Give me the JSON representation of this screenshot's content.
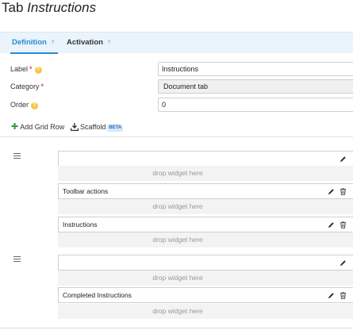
{
  "page": {
    "title_prefix": "Tab",
    "title_name": "Instructions"
  },
  "tabs": [
    {
      "label": "Definition",
      "help": "?"
    },
    {
      "label": "Activation",
      "help": "?"
    }
  ],
  "form": {
    "label": {
      "label": "Label",
      "required": "*",
      "help": "?",
      "value": "Instructions"
    },
    "category": {
      "label": "Category",
      "required": "*",
      "value": "Document tab"
    },
    "order": {
      "label": "Order",
      "help": "?",
      "value": "0"
    }
  },
  "toolbar": {
    "add_grid_row": "Add Grid Row",
    "scaffold": "Scaffold",
    "beta": "BETA"
  },
  "grid": {
    "drop_label": "drop widget here",
    "widgets": [
      {
        "title": ""
      },
      {
        "title": "Toolbar actions"
      },
      {
        "title": "Instructions"
      },
      {
        "title": ""
      },
      {
        "title": "Completed Instructions"
      }
    ]
  },
  "icons": [
    "help-icon",
    "plus-icon",
    "download-icon",
    "drag-handle-icon",
    "pencil-icon",
    "trash-icon"
  ],
  "colors": {
    "accent": "#2a8ad4",
    "tab_bar": "#eaf4fc",
    "required": "#d9534f",
    "help": "#f5c84a",
    "add": "#3c9c3c",
    "drop_zone": "#f3f3f3"
  }
}
